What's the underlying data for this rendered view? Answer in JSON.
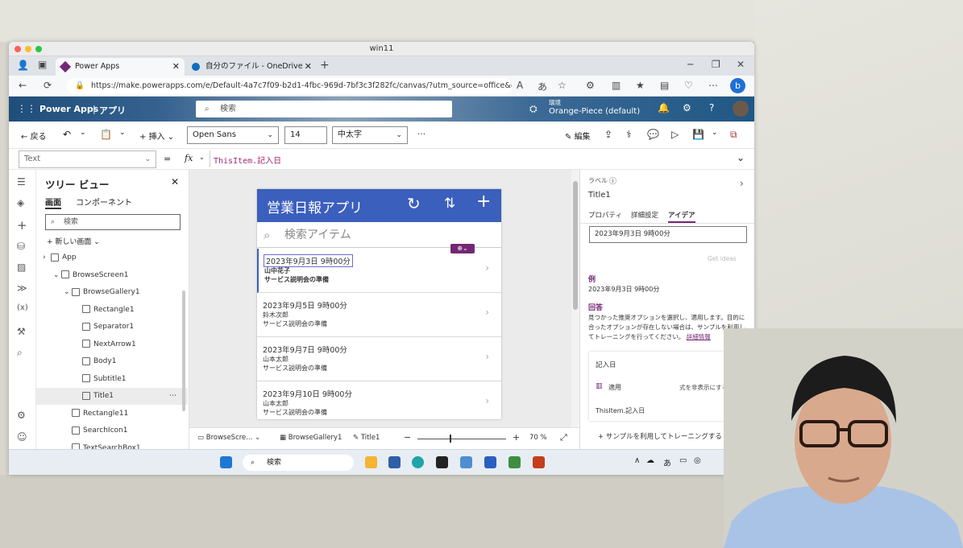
{
  "window": {
    "title": "win11"
  },
  "browser": {
    "tabs": [
      {
        "label": "Power Apps",
        "active": true
      },
      {
        "label": "自分のファイル - OneDrive",
        "active": false
      }
    ],
    "url": "https://make.powerapps.com/e/Default-4a7c7f09-b2d1-4fbc-969d-7bf3c3f282fc/canvas/?utm_source=office&utm_mediu..."
  },
  "pa_header": {
    "brand": "Power Apps",
    "section": "アプリ",
    "search_placeholder": "検索",
    "env_label": "環境",
    "env_name": "Orange-Piece (default)"
  },
  "cmdbar": {
    "back": "戻る",
    "insert": "挿入",
    "font": "Open Sans",
    "font_size": "14",
    "font_weight": "中太字",
    "edit": "編集",
    "more": "…"
  },
  "formula": {
    "property": "Text",
    "eq": "=",
    "fx": "fx",
    "value": "ThisItem.記入日"
  },
  "tree": {
    "title": "ツリー ビュー",
    "tabs": [
      "画面",
      "コンポーネント"
    ],
    "search_placeholder": "検索",
    "new_screen": "新しい画面",
    "nodes": [
      {
        "label": "App",
        "indent": 0
      },
      {
        "label": "BrowseScreen1",
        "indent": 1
      },
      {
        "label": "BrowseGallery1",
        "indent": 2
      },
      {
        "label": "Rectangle1",
        "indent": 3
      },
      {
        "label": "Separator1",
        "indent": 3
      },
      {
        "label": "NextArrow1",
        "indent": 3
      },
      {
        "label": "Body1",
        "indent": 3
      },
      {
        "label": "Subtitle1",
        "indent": 3
      },
      {
        "label": "Title1",
        "indent": 3,
        "selected": true
      },
      {
        "label": "Rectangle11",
        "indent": 2
      },
      {
        "label": "SearchIcon1",
        "indent": 2
      },
      {
        "label": "TextSearchBox1",
        "indent": 2
      }
    ]
  },
  "app": {
    "title": "営業日報アプリ",
    "search_placeholder": "検索アイテム",
    "items": [
      {
        "title": "2023年9月3日 9時00分",
        "subtitle": "山中花子",
        "body": "サービス説明会の準備",
        "selected": true
      },
      {
        "title": "2023年9月5日 9時00分",
        "subtitle": "鈴木次郎",
        "body": "サービス説明会の準備"
      },
      {
        "title": "2023年9月7日 9時00分",
        "subtitle": "山本太郎",
        "body": "サービス説明会の準備"
      },
      {
        "title": "2023年9月10日 9時00分",
        "subtitle": "山本太郎",
        "body": "サービス説明会の準備"
      }
    ]
  },
  "status": {
    "screen": "BrowseScre...",
    "gallery": "BrowseGallery1",
    "control": "Title1",
    "zoom": "70",
    "zoom_unit": "%"
  },
  "rpanel": {
    "type_label": "ラベル",
    "control_name": "Title1",
    "tabs": [
      "プロパティ",
      "詳細設定",
      "アイデア"
    ],
    "input_value": "2023年9月3日 9時00分",
    "get_ideas": "Get ideas",
    "example_label": "例",
    "example_value": "2023年9月3日 9時00分",
    "answer_label": "回答",
    "answer_text": "見つかった推奨オプションを選択し、適用します。目的に合ったオプションが存在しない場合は、サンプルを利用してトレーニングを行ってください。",
    "more_info": "詳細情報",
    "card_field": "記入日",
    "apply": "適用",
    "show_formula": "式を非表示にする",
    "formula": "ThisItem.記入日",
    "train": "サンプルを利用してトレーニングする"
  },
  "taskbar": {
    "search": "検索"
  }
}
